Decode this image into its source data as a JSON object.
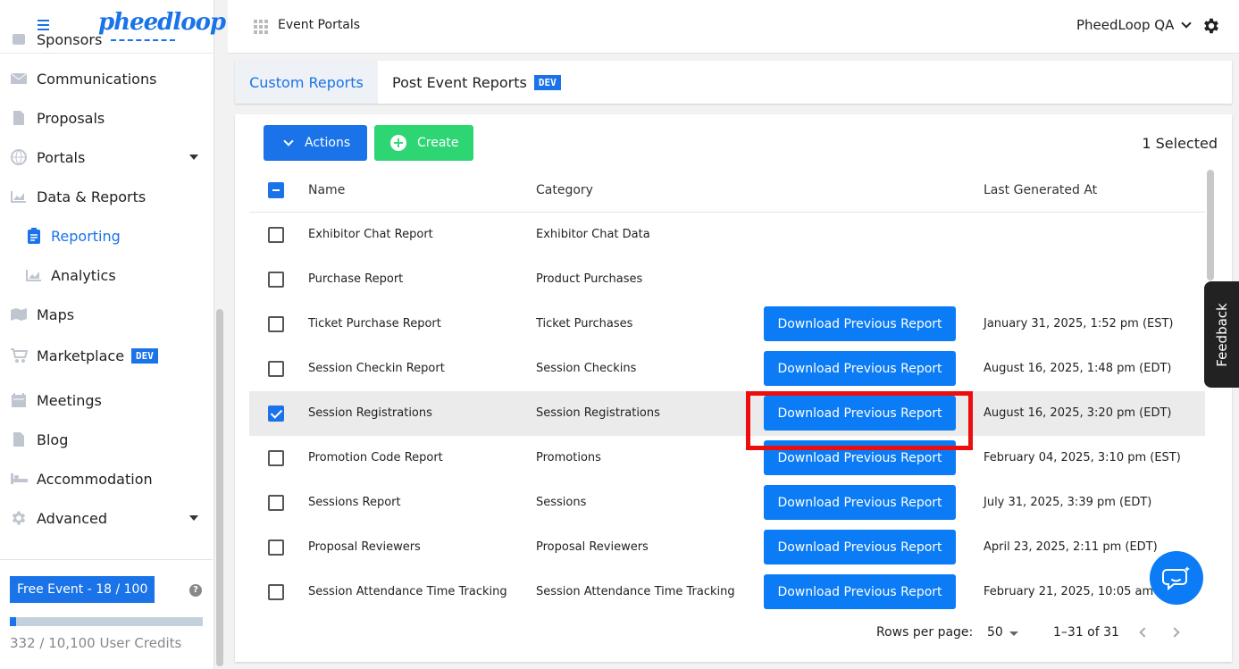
{
  "sidebar": {
    "items": [
      {
        "label": "Sponsors",
        "icon": "sponsor-icon"
      },
      {
        "label": "Communications",
        "icon": "envelope-icon"
      },
      {
        "label": "Proposals",
        "icon": "document-icon"
      },
      {
        "label": "Portals",
        "icon": "globe-icon"
      },
      {
        "label": "Data & Reports",
        "icon": "chart-icon"
      },
      {
        "label": "Reporting",
        "icon": "clipboard-icon"
      },
      {
        "label": "Analytics",
        "icon": "chart-icon"
      },
      {
        "label": "Maps",
        "icon": "map-icon"
      },
      {
        "label": "Marketplace",
        "icon": "cart-icon",
        "badge": "DEV"
      },
      {
        "label": "Meetings",
        "icon": "calendar-icon"
      },
      {
        "label": "Blog",
        "icon": "document-icon"
      },
      {
        "label": "Accommodation",
        "icon": "bed-icon"
      },
      {
        "label": "Advanced",
        "icon": "gear-icon"
      }
    ],
    "plan_label": "Free Event - 18 / 100",
    "credits_text": "332 / 10,100 User Credits",
    "credits_used_fraction": 0.033
  },
  "topbar": {
    "title": "Event Portals",
    "org": "PheedLoop QA"
  },
  "tabs": [
    {
      "label": "Custom Reports",
      "active": true
    },
    {
      "label": "Post Event Reports",
      "badge": "DEV"
    }
  ],
  "toolbar": {
    "actions_label": "Actions",
    "create_label": "Create",
    "selected_text": "1 Selected"
  },
  "table": {
    "columns": [
      "Name",
      "Category",
      "Last Generated At"
    ],
    "download_label": "Download Previous Report",
    "rows": [
      {
        "name": "Exhibitor Chat Report",
        "category": "Exhibitor Chat Data",
        "last": "",
        "download": false,
        "checked": false
      },
      {
        "name": "Purchase Report",
        "category": "Product Purchases",
        "last": "",
        "download": false,
        "checked": false
      },
      {
        "name": "Ticket Purchase Report",
        "category": "Ticket Purchases",
        "last": "January 31, 2025, 1:52 pm (EST)",
        "download": true,
        "checked": false
      },
      {
        "name": "Session Checkin Report",
        "category": "Session Checkins",
        "last": "August 16, 2025, 1:48 pm (EDT)",
        "download": true,
        "checked": false
      },
      {
        "name": "Session Registrations",
        "category": "Session Registrations",
        "last": "August 16, 2025, 3:20 pm (EDT)",
        "download": true,
        "checked": true
      },
      {
        "name": "Promotion Code Report",
        "category": "Promotions",
        "last": "February 04, 2025, 3:10 pm (EST)",
        "download": true,
        "checked": false
      },
      {
        "name": "Sessions Report",
        "category": "Sessions",
        "last": "July 31, 2025, 3:39 pm (EDT)",
        "download": true,
        "checked": false
      },
      {
        "name": "Proposal Reviewers",
        "category": "Proposal Reviewers",
        "last": "April 23, 2025, 2:11 pm (EDT)",
        "download": true,
        "checked": false
      },
      {
        "name": "Session Attendance Time Tracking",
        "category": "Session Attendance Time Tracking",
        "last": "February 21, 2025, 10:05 am (E",
        "download": true,
        "checked": false
      }
    ]
  },
  "pagination": {
    "rows_per_page_label": "Rows per page:",
    "rows_per_page": "50",
    "range": "1–31 of 31"
  },
  "feedback_label": "Feedback",
  "colors": {
    "accent": "#1a73e8",
    "create": "#2ed573",
    "highlight": "#ee0d0d"
  }
}
